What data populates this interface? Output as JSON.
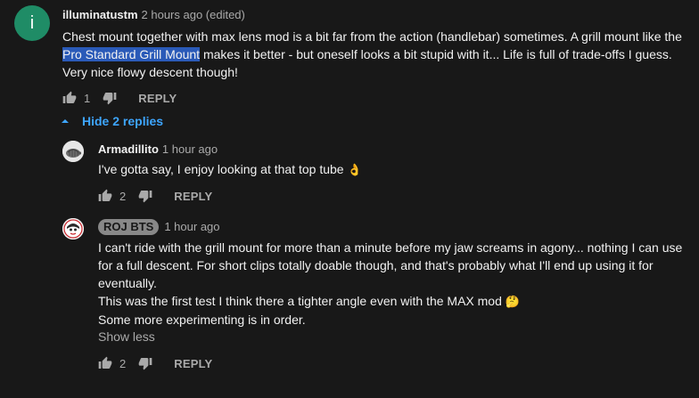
{
  "comment": {
    "avatar_letter": "i",
    "author": "illuminatustm",
    "time": "2 hours ago (edited)",
    "text_before": "Chest mount together with max lens mod is a bit far from the action (handlebar) sometimes. A grill mount like the ",
    "text_highlight": "Pro Standard Grill Mount",
    "text_after": " makes it better - but oneself looks a bit stupid with it... Life is full of trade-offs I guess. Very nice flowy descent though!",
    "likes": "1",
    "reply_label": "REPLY"
  },
  "hide_replies_label": "Hide 2 replies",
  "replies": [
    {
      "author": "Armadillito",
      "time": "1 hour ago",
      "text": "I've gotta say, I enjoy looking at that top tube",
      "emoji": "👌",
      "likes": "2",
      "reply_label": "REPLY"
    },
    {
      "author": "ROJ BTS",
      "time": "1 hour ago",
      "line1": "I can't ride with the grill mount for more than a minute before my jaw screams in agony... nothing I can use for a full descent. For short clips totally doable though, and that's probably what I'll end up using it for eventually.",
      "line2": "This was the first test I think there a tighter angle even with the MAX mod",
      "line2_emoji": "🤔",
      "line3": "Some more experimenting is in order.",
      "show_less_label": "Show less",
      "likes": "2",
      "reply_label": "REPLY"
    }
  ],
  "colors": {
    "background": "#181818",
    "link_blue": "#3ea6ff",
    "selection": "#2a5ab8",
    "avatar_green": "#1f8c66"
  }
}
